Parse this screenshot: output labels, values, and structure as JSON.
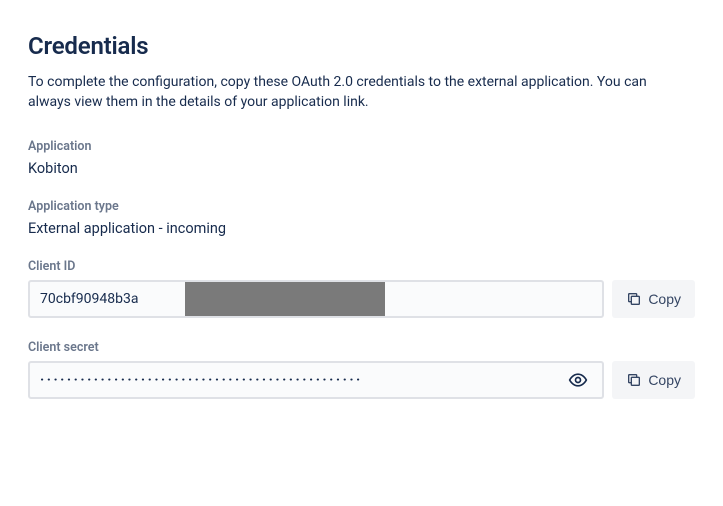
{
  "title": "Credentials",
  "description": "To complete the configuration, copy these OAuth 2.0 credentials to the external application. You can always view them in the details of your application link.",
  "fields": {
    "application": {
      "label": "Application",
      "value": "Kobiton"
    },
    "application_type": {
      "label": "Application type",
      "value": "External application - incoming"
    },
    "client_id": {
      "label": "Client ID",
      "value": "70cbf90948b3a",
      "copy_label": "Copy"
    },
    "client_secret": {
      "label": "Client secret",
      "masked": "················································",
      "copy_label": "Copy"
    }
  }
}
